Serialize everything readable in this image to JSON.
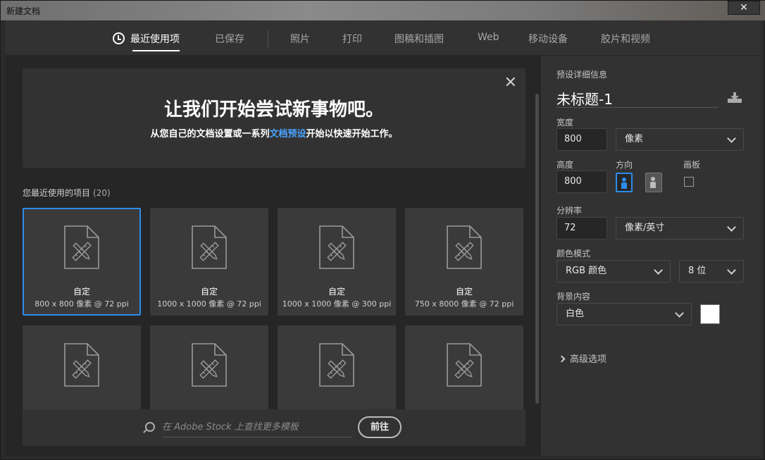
{
  "window": {
    "title": "新建文档",
    "close_glyph": "✕"
  },
  "tabs": [
    {
      "label": "最近使用项",
      "icon": "clock-icon",
      "active": true
    },
    {
      "label": "已保存"
    },
    {
      "label": "照片"
    },
    {
      "label": "打印"
    },
    {
      "label": "图稿和插图"
    },
    {
      "label": "Web"
    },
    {
      "label": "移动设备"
    },
    {
      "label": "胶片和视频"
    }
  ],
  "banner": {
    "headline": "让我们开始尝试新事物吧。",
    "sub_before": "从您自己的文档设置或一系列",
    "sub_link": "文档预设",
    "sub_after": "开始以快速开始工作。",
    "close_glyph": "✕"
  },
  "recent": {
    "label": "您最近使用的项目",
    "count": "(20)",
    "items": [
      {
        "name": "自定",
        "dims": "800 x 800 像素 @ 72 ppi",
        "selected": true
      },
      {
        "name": "自定",
        "dims": "1000 x 1000 像素 @ 72 ppi"
      },
      {
        "name": "自定",
        "dims": "1000 x 1000 像素 @ 300 ppi"
      },
      {
        "name": "自定",
        "dims": "750 x 8000 像素 @ 72 ppi"
      },
      {
        "name": "",
        "dims": ""
      },
      {
        "name": "",
        "dims": ""
      },
      {
        "name": "",
        "dims": ""
      },
      {
        "name": "",
        "dims": ""
      }
    ]
  },
  "stock": {
    "placeholder": "在 Adobe Stock 上查找更多模板",
    "go_label": "前往"
  },
  "preset": {
    "section_label": "预设详细信息",
    "doc_name": "未标题-1",
    "width_label": "宽度",
    "width_value": "800",
    "width_unit": "像素",
    "height_label": "高度",
    "height_value": "800",
    "orientation_label": "方向",
    "artboard_label": "画板",
    "resolution_label": "分辨率",
    "resolution_value": "72",
    "resolution_unit": "像素/英寸",
    "color_mode_label": "颜色模式",
    "color_mode_value": "RGB 颜色",
    "bit_depth": "8 位",
    "background_label": "背景内容",
    "background_value": "白色",
    "background_color": "#ffffff",
    "advanced_label": "高级选项"
  },
  "colors": {
    "accent": "#2d8ceb",
    "link": "#4aa3ff"
  }
}
